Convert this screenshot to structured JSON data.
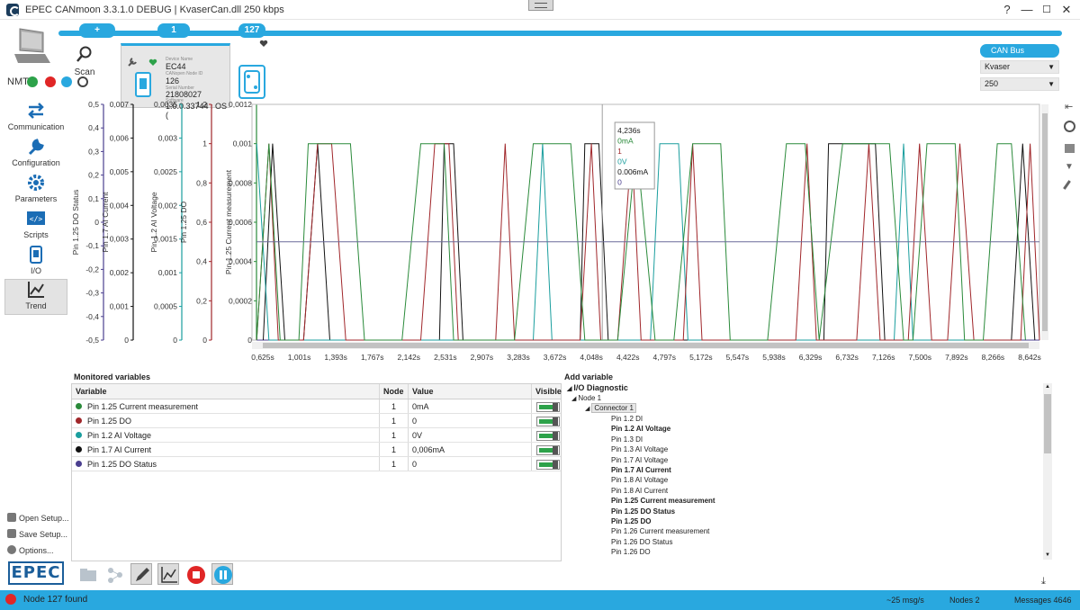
{
  "window": {
    "title": "EPEC CANmoon 3.3.1.0 DEBUG | KvaserCan.dll 250 kbps",
    "minimize": "—",
    "maximize": "☐",
    "close": "✕",
    "help": "?"
  },
  "bus": {
    "add_label": "+",
    "node1_tab": "1",
    "node127_tab": "127",
    "canbus_label": "CAN Bus",
    "interface_value": "Kvaser",
    "baud_value": "250"
  },
  "scan": {
    "label": "Scan"
  },
  "node_card": {
    "device_name_label": "Device Name",
    "device_name": "EC44",
    "node_id_label": "CANopen Node ID",
    "node_id": "126",
    "serial_label": "Serial Number",
    "serial": "21808027",
    "software_label": "Software",
    "software": "1.0.0.33744 : OS ("
  },
  "nmt": {
    "label": "NMT"
  },
  "sidebar": {
    "items": [
      {
        "label": "Communication"
      },
      {
        "label": "Configuration"
      },
      {
        "label": "Parameters"
      },
      {
        "label": "Scripts"
      },
      {
        "label": "I/O"
      },
      {
        "label": "Trend"
      }
    ],
    "open_setup": "Open Setup...",
    "save_setup": "Save Setup...",
    "options": "Options...",
    "logo": "EPEC"
  },
  "chart_data": {
    "type": "line",
    "x_range": [
      0.5,
      8.9
    ],
    "x_ticks": [
      "0,625s",
      "1,001s",
      "1,393s",
      "1,767s",
      "2,142s",
      "2,531s",
      "2,907s",
      "3,283s",
      "3,672s",
      "4,048s",
      "4,422s",
      "4,797s",
      "5,172s",
      "5,547s",
      "5,938s",
      "6,329s",
      "6,732s",
      "7,126s",
      "7,500s",
      "7,892s",
      "8,266s",
      "8,642s"
    ],
    "axes": [
      {
        "label": "Pin 1.25 DO Status",
        "color": "#4b3f8f",
        "ticks": [
          "0,5",
          "0,4",
          "0,3",
          "0,2",
          "0,1",
          "0",
          "-0,1",
          "-0,2",
          "-0,3",
          "-0,4",
          "-0,5"
        ]
      },
      {
        "label": "Pin 1.7 AI Current",
        "color": "#111111",
        "ticks": [
          "0,007",
          "0,006",
          "0,005",
          "0,004",
          "0,003",
          "0,002",
          "0,001",
          "0"
        ]
      },
      {
        "label": "Pin 1.2 AI Voltage",
        "color": "#1a9e9e",
        "ticks": [
          "0,0035",
          "0,003",
          "0,0025",
          "0,002",
          "0,0015",
          "0,001",
          "0,0005",
          "0"
        ]
      },
      {
        "label": "Pin 1.25 DO",
        "color": "#a0262a",
        "ticks": [
          "1,2",
          "1",
          "0,8",
          "0,6",
          "0,4",
          "0,2",
          "0"
        ]
      },
      {
        "label": "Pin 1.25 Current measurement",
        "color": "#2a8a3a",
        "ticks": [
          "0,0012",
          "0,001",
          "0,0008",
          "0,0006",
          "0,0004",
          "0,0002",
          "0"
        ]
      }
    ],
    "series": [
      {
        "name": "Pin 1.25 DO Status",
        "color": "#4b3f8f",
        "points": [
          [
            0.55,
            0
          ],
          [
            8.9,
            0
          ]
        ]
      },
      {
        "name": "Pin 1.7 AI Current",
        "color": "#111111",
        "points": [
          [
            0.62,
            0
          ],
          [
            0.72,
            1
          ],
          [
            0.85,
            0
          ],
          [
            1.05,
            0
          ],
          [
            1.2,
            1
          ],
          [
            1.33,
            0
          ],
          [
            2.5,
            0
          ],
          [
            2.55,
            1
          ],
          [
            2.65,
            1
          ],
          [
            2.75,
            0
          ],
          [
            3.5,
            0
          ],
          [
            3.6,
            0
          ],
          [
            4.0,
            0
          ],
          [
            4.05,
            1
          ],
          [
            4.2,
            1
          ],
          [
            4.3,
            0
          ],
          [
            4.45,
            0
          ],
          [
            6.6,
            0
          ],
          [
            6.65,
            1
          ],
          [
            7.15,
            1
          ],
          [
            7.25,
            0
          ],
          [
            8.6,
            0
          ],
          [
            8.72,
            1
          ],
          [
            8.85,
            0
          ]
        ]
      },
      {
        "name": "Pin 1.2 AI Voltage",
        "color": "#1a9e9e",
        "points": [
          [
            0.55,
            1
          ],
          [
            0.68,
            0
          ],
          [
            3.5,
            0
          ],
          [
            3.6,
            1
          ],
          [
            3.7,
            0
          ],
          [
            4.75,
            0
          ],
          [
            4.85,
            1
          ],
          [
            5.05,
            1
          ],
          [
            5.15,
            0
          ],
          [
            7.35,
            0
          ],
          [
            7.45,
            1
          ],
          [
            7.55,
            0
          ],
          [
            8.7,
            0
          ]
        ]
      },
      {
        "name": "Pin 1.25 DO",
        "color": "#a0262a",
        "points": [
          [
            0.55,
            0
          ],
          [
            0.68,
            1
          ],
          [
            0.78,
            0
          ],
          [
            1.05,
            0
          ],
          [
            1.2,
            1
          ],
          [
            1.35,
            1
          ],
          [
            1.5,
            0
          ],
          [
            2.3,
            0
          ],
          [
            2.45,
            1
          ],
          [
            2.6,
            1
          ],
          [
            2.7,
            0
          ],
          [
            3.1,
            0
          ],
          [
            3.2,
            1
          ],
          [
            3.3,
            0
          ],
          [
            4.0,
            0
          ],
          [
            4.12,
            1
          ],
          [
            4.22,
            0
          ],
          [
            4.4,
            0
          ],
          [
            4.55,
            1
          ],
          [
            4.65,
            0
          ],
          [
            5.1,
            0
          ],
          [
            5.2,
            1
          ],
          [
            5.3,
            0
          ],
          [
            6.3,
            0
          ],
          [
            6.42,
            1
          ],
          [
            6.52,
            0
          ],
          [
            6.95,
            0
          ],
          [
            7.08,
            1
          ],
          [
            7.2,
            0
          ],
          [
            7.5,
            0
          ],
          [
            7.62,
            1
          ],
          [
            7.75,
            0
          ],
          [
            7.92,
            0
          ],
          [
            8.05,
            1
          ],
          [
            8.2,
            0
          ],
          [
            8.7,
            0
          ],
          [
            8.8,
            1
          ],
          [
            8.9,
            0
          ]
        ]
      },
      {
        "name": "Pin 1.25 Current measurement",
        "color": "#2a8a3a",
        "points": [
          [
            0.55,
            0
          ],
          [
            0.68,
            1
          ],
          [
            0.8,
            0
          ],
          [
            1.0,
            0
          ],
          [
            1.1,
            1
          ],
          [
            1.4,
            1
          ],
          [
            1.55,
            1
          ],
          [
            1.7,
            0
          ],
          [
            2.1,
            0
          ],
          [
            2.3,
            1
          ],
          [
            2.55,
            1
          ],
          [
            2.65,
            0
          ],
          [
            3.3,
            0
          ],
          [
            3.5,
            1
          ],
          [
            3.9,
            1
          ],
          [
            4.05,
            0
          ],
          [
            4.3,
            0
          ],
          [
            4.4,
            0
          ],
          [
            4.6,
            1
          ],
          [
            4.8,
            0
          ],
          [
            5.0,
            0
          ],
          [
            5.2,
            1
          ],
          [
            5.5,
            1
          ],
          [
            5.6,
            0
          ],
          [
            6.0,
            0
          ],
          [
            6.2,
            1
          ],
          [
            6.4,
            1
          ],
          [
            6.55,
            0
          ],
          [
            6.8,
            1
          ],
          [
            7.3,
            1
          ],
          [
            7.45,
            0
          ],
          [
            7.55,
            0
          ],
          [
            7.7,
            1
          ],
          [
            8.0,
            1
          ],
          [
            8.1,
            0
          ],
          [
            8.3,
            0
          ],
          [
            8.45,
            1
          ],
          [
            8.6,
            1
          ],
          [
            8.75,
            0
          ]
        ]
      },
      {
        "name": "Pin 1.25 DO Status reference",
        "color": "#6b6b9a",
        "points": [
          [
            0.55,
            0.5
          ],
          [
            8.9,
            0.5
          ]
        ]
      }
    ],
    "cursor_x": 4.236,
    "tooltip": [
      {
        "text": "4,236s",
        "color": "#222222"
      },
      {
        "text": "0mA",
        "color": "#2a8a3a"
      },
      {
        "text": "1",
        "color": "#a0262a"
      },
      {
        "text": "0V",
        "color": "#1a9e9e"
      },
      {
        "text": "0.006mA",
        "color": "#111111"
      },
      {
        "text": "0",
        "color": "#4b3f8f"
      }
    ]
  },
  "monitored": {
    "title": "Monitored variables",
    "headers": {
      "variable": "Variable",
      "node": "Node",
      "value": "Value",
      "visible": "Visible"
    },
    "rows": [
      {
        "variable": "Pin 1.25 Current measurement",
        "node": "1",
        "value": "0mA",
        "color": "#2a8a3a"
      },
      {
        "variable": "Pin 1.25 DO",
        "node": "1",
        "value": "0",
        "color": "#a0262a"
      },
      {
        "variable": "Pin 1.2 AI Voltage",
        "node": "1",
        "value": "0V",
        "color": "#1a9e9e"
      },
      {
        "variable": "Pin 1.7 AI Current",
        "node": "1",
        "value": "0,006mA",
        "color": "#111111"
      },
      {
        "variable": "Pin 1.25 DO Status",
        "node": "1",
        "value": "0",
        "color": "#4b3f8f"
      }
    ]
  },
  "add_variable": {
    "title": "Add variable",
    "root": "I/O Diagnostic",
    "node": "Node 1",
    "connector": "Connector 1",
    "items": [
      {
        "label": "Pin 1.2 DI",
        "bold": false
      },
      {
        "label": "Pin 1.2 AI Voltage",
        "bold": true
      },
      {
        "label": "Pin 1.3 DI",
        "bold": false
      },
      {
        "label": "Pin 1.3 AI Voltage",
        "bold": false
      },
      {
        "label": "Pin 1.7 AI Voltage",
        "bold": false
      },
      {
        "label": "Pin 1.7 AI Current",
        "bold": true
      },
      {
        "label": "Pin 1.8 AI Voltage",
        "bold": false
      },
      {
        "label": "Pin 1.8 AI Current",
        "bold": false
      },
      {
        "label": "Pin 1.25 Current measurement",
        "bold": true
      },
      {
        "label": "Pin 1.25 DO Status",
        "bold": true
      },
      {
        "label": "Pin 1.25 DO",
        "bold": true
      },
      {
        "label": "Pin 1.26 Current measurement",
        "bold": false
      },
      {
        "label": "Pin 1.26 DO Status",
        "bold": false
      },
      {
        "label": "Pin 1.26 DO",
        "bold": false
      }
    ]
  },
  "status": {
    "message": "Node 127 found",
    "rate": "~25 msg/s",
    "nodes": "Nodes 2",
    "messages": "Messages 4646"
  },
  "colors": {
    "accent": "#29a8df"
  }
}
